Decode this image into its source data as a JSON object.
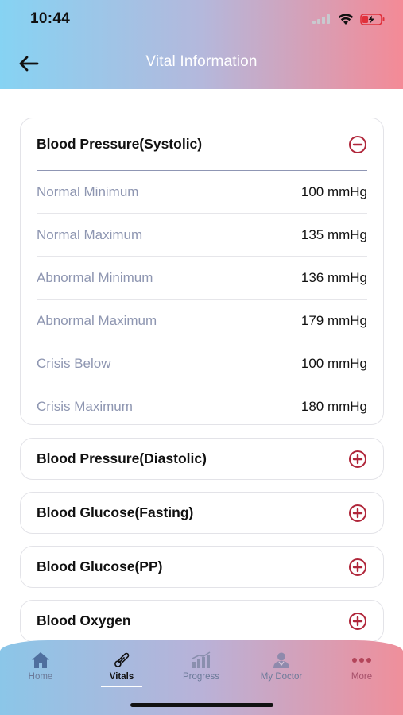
{
  "status_bar": {
    "time": "10:44"
  },
  "header": {
    "title": "Vital Information"
  },
  "expanded_card": {
    "title": "Blood Pressure(Systolic)",
    "rows": [
      {
        "label": "Normal Minimum",
        "value": "100 mmHg"
      },
      {
        "label": "Normal Maximum",
        "value": "135 mmHg"
      },
      {
        "label": "Abnormal Minimum",
        "value": "136 mmHg"
      },
      {
        "label": "Abnormal Maximum",
        "value": "179 mmHg"
      },
      {
        "label": "Crisis Below",
        "value": "100 mmHg"
      },
      {
        "label": "Crisis Maximum",
        "value": "180 mmHg"
      }
    ]
  },
  "collapsed_cards": [
    {
      "title": "Blood Pressure(Diastolic)"
    },
    {
      "title": "Blood Glucose(Fasting)"
    },
    {
      "title": "Blood Glucose(PP)"
    },
    {
      "title": "Blood Oxygen"
    }
  ],
  "tabs": [
    {
      "label": "Home",
      "icon": "home-icon"
    },
    {
      "label": "Vitals",
      "icon": "thermometer-icon",
      "active": true
    },
    {
      "label": "Progress",
      "icon": "bar-chart-icon"
    },
    {
      "label": "My Doctor",
      "icon": "doctor-icon"
    },
    {
      "label": "More",
      "icon": "more-dots-icon"
    }
  ],
  "colors": {
    "accent": "#b0263a",
    "label_gray": "#8e96b1",
    "header_start": "#86d3f3",
    "header_end": "#f48a96"
  }
}
